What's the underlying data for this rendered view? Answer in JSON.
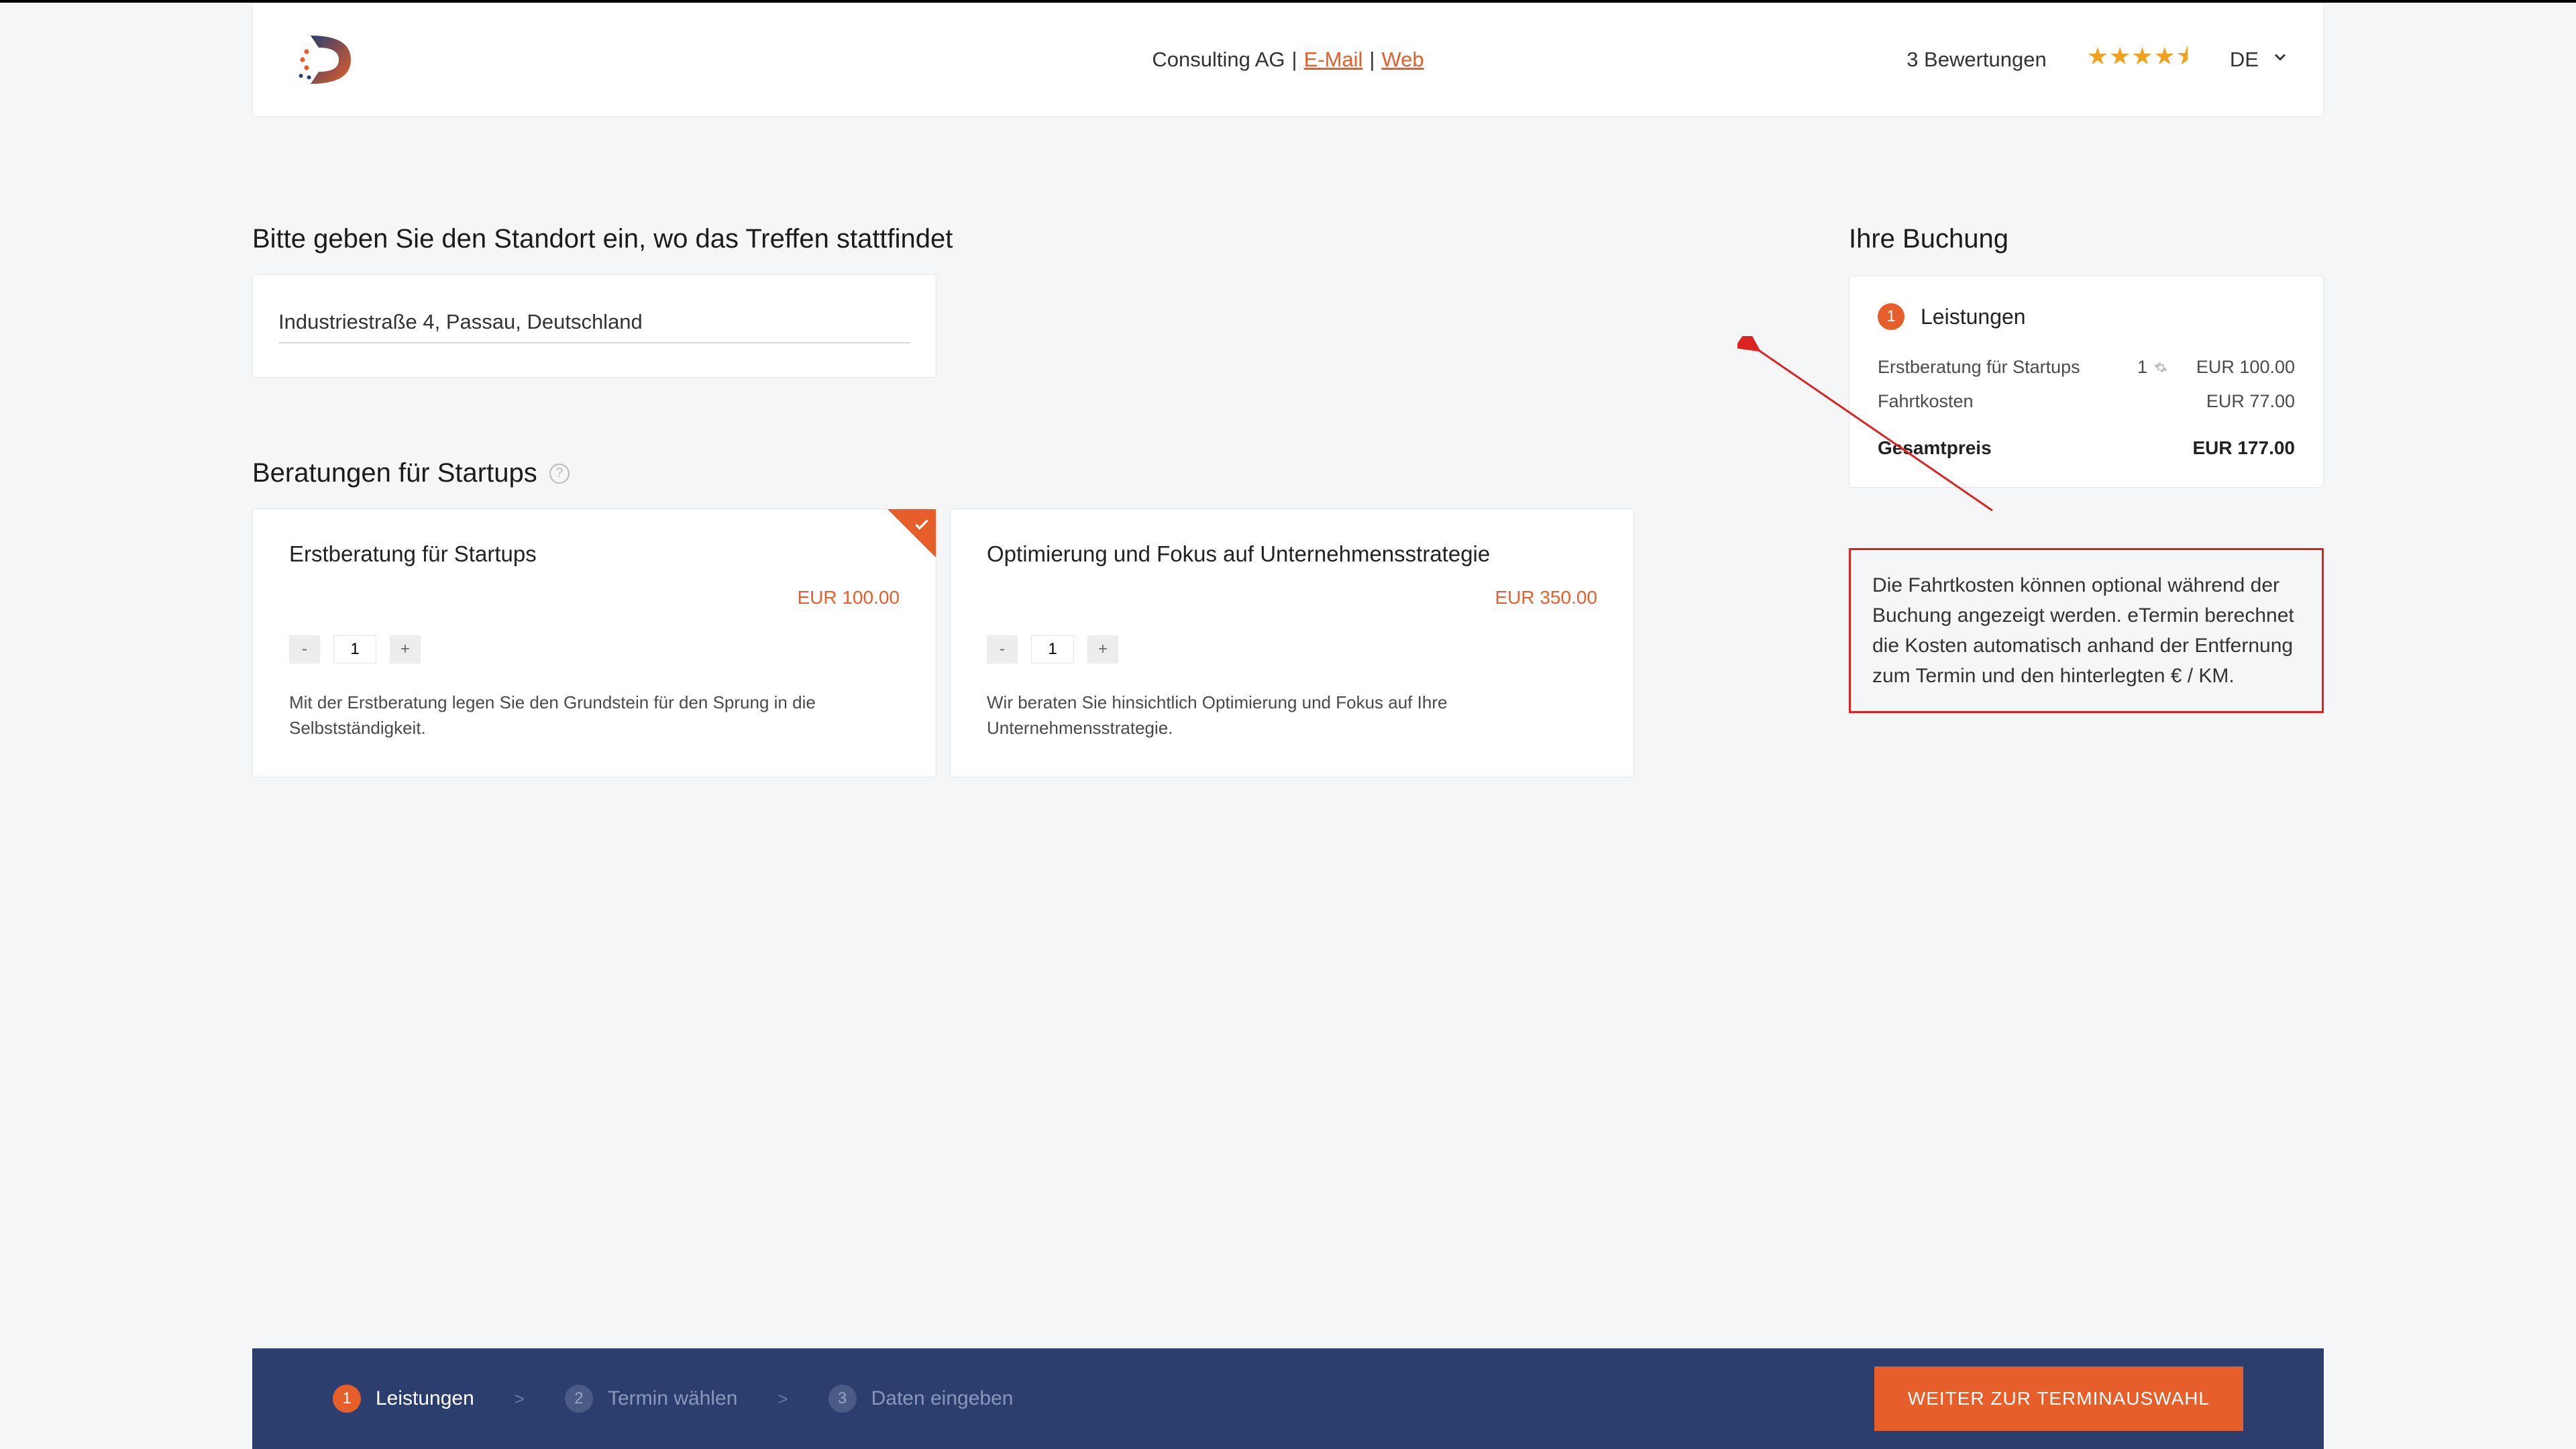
{
  "header": {
    "company": "Consulting AG",
    "sep": " | ",
    "email_label": "E-Mail",
    "web_label": "Web",
    "reviews_label": "3 Bewertungen",
    "lang": "DE"
  },
  "location": {
    "title": "Bitte geben Sie den Standort ein, wo das Treffen stattfindet",
    "value": "Industriestraße 4, Passau, Deutschland"
  },
  "services": {
    "title": "Beratungen für Startups",
    "cards": [
      {
        "title": "Erstberatung für Startups",
        "price": "EUR 100.00",
        "qty": "1",
        "desc": "Mit der Erstberatung legen Sie den Grundstein für den Sprung in die Selbstständigkeit.",
        "selected": true
      },
      {
        "title": "Optimierung und Fokus auf Unternehmensstrategie",
        "price": "EUR 350.00",
        "qty": "1",
        "desc": "Wir beraten Sie hinsichtlich Optimierung und Fokus auf Ihre Unternehmensstrategie.",
        "selected": false
      }
    ]
  },
  "booking": {
    "title": "Ihre Buchung",
    "step_num": "1",
    "step_label": "Leistungen",
    "rows": [
      {
        "label": "Erstberatung für Startups",
        "qty": "1",
        "price": "EUR 100.00"
      },
      {
        "label": "Fahrtkosten",
        "qty": "",
        "price": "EUR 77.00"
      }
    ],
    "total_label": "Gesamtpreis",
    "total_price": "EUR 177.00"
  },
  "callout": {
    "text": "Die Fahrtkosten können optional während der Buchung angezeigt werden. eTermin berechnet die Kosten automatisch anhand der Entfernung zum Termin und den hinterlegten € / KM."
  },
  "footer": {
    "steps": [
      {
        "num": "1",
        "label": "Leistungen",
        "active": true
      },
      {
        "num": "2",
        "label": "Termin wählen",
        "active": false
      },
      {
        "num": "3",
        "label": "Daten eingeben",
        "active": false
      }
    ],
    "sep": ">",
    "next": "WEITER ZUR TERMINAUSWAHL"
  }
}
